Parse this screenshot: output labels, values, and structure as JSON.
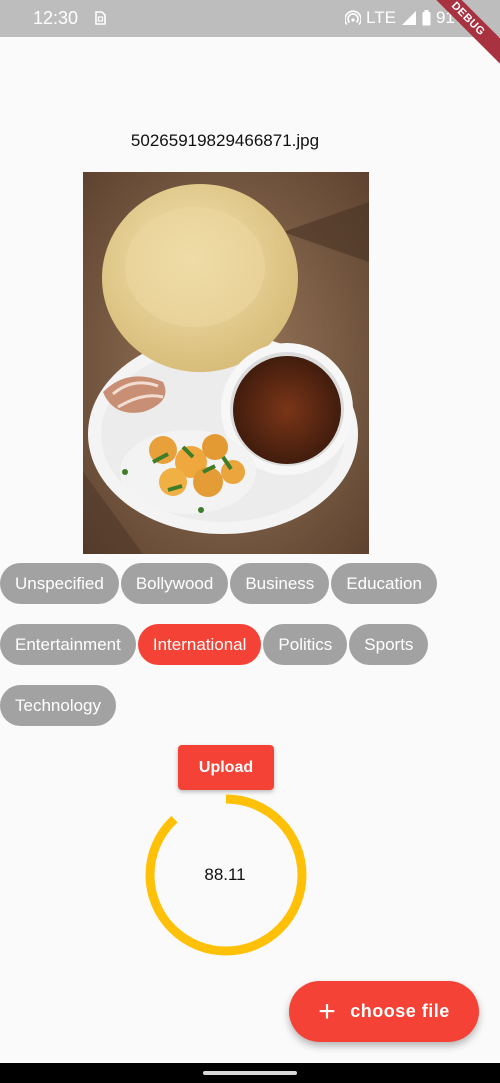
{
  "status_bar": {
    "time": "12:30",
    "network": "LTE",
    "battery": "91%"
  },
  "debug_banner": "DEBUG",
  "file_name": "50265919829466871.jpg",
  "categories": [
    {
      "label": "Unspecified",
      "selected": false
    },
    {
      "label": "Bollywood",
      "selected": false
    },
    {
      "label": "Business",
      "selected": false
    },
    {
      "label": "Education",
      "selected": false
    },
    {
      "label": "Entertainment",
      "selected": false
    },
    {
      "label": "International",
      "selected": true
    },
    {
      "label": "Politics",
      "selected": false
    },
    {
      "label": "Sports",
      "selected": false
    },
    {
      "label": "Technology",
      "selected": false
    }
  ],
  "upload_label": "Upload",
  "progress": {
    "value_label": "88.11",
    "fraction": 0.8811,
    "color": "#ffc107"
  },
  "fab": {
    "icon": "plus-icon",
    "label": "choose file"
  },
  "colors": {
    "accent": "#f44336",
    "chip": "#a2a2a2"
  }
}
